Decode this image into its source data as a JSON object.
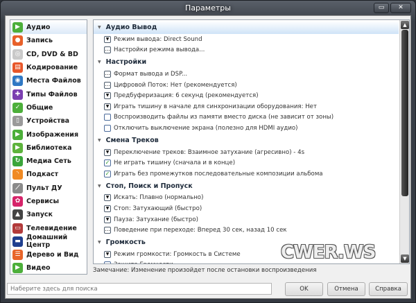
{
  "window": {
    "title": "Параметры",
    "maximize_icon": "maximize-icon",
    "close_icon": "close-icon"
  },
  "sidebar": {
    "items": [
      {
        "label": "Аудио",
        "icon": "audio-icon",
        "color": "#4caf3a",
        "glyph": "▶"
      },
      {
        "label": "Запись",
        "icon": "record-icon",
        "color": "#e8612a",
        "glyph": "●"
      },
      {
        "label": "CD, DVD & BD",
        "icon": "disc-icon",
        "color": "#c9c9c9",
        "glyph": "◎"
      },
      {
        "label": "Кодирование",
        "icon": "encode-icon",
        "color": "#e8572a",
        "glyph": "▤"
      },
      {
        "label": "Места Файлов",
        "icon": "globe-icon",
        "color": "#2f78c4",
        "glyph": "◉"
      },
      {
        "label": "Типы Файлов",
        "icon": "puzzle-icon",
        "color": "#7b3fb0",
        "glyph": "✚"
      },
      {
        "label": "Общие",
        "icon": "check-icon",
        "color": "#4caf3a",
        "glyph": "✓"
      },
      {
        "label": "Устройства",
        "icon": "device-icon",
        "color": "#9a9a9a",
        "glyph": "▯"
      },
      {
        "label": "Изображения",
        "icon": "images-icon",
        "color": "#4caf3a",
        "glyph": "▶"
      },
      {
        "label": "Библиотека",
        "icon": "library-icon",
        "color": "#5db33c",
        "glyph": "▶"
      },
      {
        "label": "Медиа Сеть",
        "icon": "network-icon",
        "color": "#3ba53b",
        "glyph": "↻"
      },
      {
        "label": "Подкаст",
        "icon": "rss-icon",
        "color": "#f08a24",
        "glyph": "◝"
      },
      {
        "label": "Пульт ДУ",
        "icon": "remote-icon",
        "color": "#8a8a8a",
        "glyph": "⟋"
      },
      {
        "label": "Сервисы",
        "icon": "services-icon",
        "color": "#d6246a",
        "glyph": "✿"
      },
      {
        "label": "Запуск",
        "icon": "launch-icon",
        "color": "#444444",
        "glyph": "▲"
      },
      {
        "label": "Телевидение",
        "icon": "tv-icon",
        "color": "#b23a3a",
        "glyph": "▭"
      },
      {
        "label": "Домашний Центр",
        "icon": "theater-icon",
        "color": "#1f3f8f",
        "glyph": "▬"
      },
      {
        "label": "Дерево и Вид",
        "icon": "tree-icon",
        "color": "#e8652a",
        "glyph": "☰"
      },
      {
        "label": "Видео",
        "icon": "video-icon",
        "color": "#4caf3a",
        "glyph": "▶"
      }
    ]
  },
  "sections": [
    {
      "title": "Аудио Вывод",
      "items": [
        {
          "type": "dropdown",
          "label": "Режим вывода: Direct Sound"
        },
        {
          "type": "ellipsis",
          "label": "Настройки режима вывода..."
        }
      ]
    },
    {
      "title": "Настройки",
      "items": [
        {
          "type": "ellipsis",
          "label": "Формат вывода и DSP..."
        },
        {
          "type": "ellipsis",
          "label": "Цифровой Поток: Нет (рекомендуется)"
        },
        {
          "type": "dropdown",
          "label": "Предбуферизация: 6 секунд (рекомендуется)"
        },
        {
          "type": "dropdown",
          "label": "Играть тишину в начале для синхронизации оборудования: Нет"
        },
        {
          "type": "checkbox",
          "checked": false,
          "label": "Воспроизводить файлы из памяти вместо диска (не зависит от зоны)"
        },
        {
          "type": "checkbox",
          "checked": false,
          "label": "Отключить выключение экрана (полезно для HDMI аудио)"
        }
      ]
    },
    {
      "title": "Смена Треков",
      "items": [
        {
          "type": "dropdown",
          "label": "Переключение треков: Взаимное затухание (агресивно) - 4s"
        },
        {
          "type": "checkbox",
          "checked": true,
          "label": "Не играть тишину (сначала и в конце)"
        },
        {
          "type": "checkbox",
          "checked": true,
          "label": "Играть без промежутков последовательные композиции альбома"
        }
      ]
    },
    {
      "title": "Стоп, Поиск и Пропуск",
      "items": [
        {
          "type": "dropdown",
          "label": "Искать: Плавно (нормально)"
        },
        {
          "type": "dropdown",
          "label": "Стоп: Затухающий (быстро)"
        },
        {
          "type": "dropdown",
          "label": "Пауза: Затухание (быстро)"
        },
        {
          "type": "ellipsis",
          "label": "Поведение при переходе: Вперед 30 сек, назад 10 сек"
        }
      ]
    },
    {
      "title": "Громкость",
      "items": [
        {
          "type": "dropdown",
          "label": "Режим громкости: Громкость в Системе"
        },
        {
          "type": "checkbox",
          "checked": false,
          "label": "Защита Громкости"
        }
      ]
    }
  ],
  "watermark": "CWER.WS",
  "note": "Замечание: Изменение произойдет после остановки воспроизведения",
  "search": {
    "placeholder": "Наберите здесь для поиска",
    "value": ""
  },
  "buttons": {
    "ok": "OK",
    "cancel": "Отмена",
    "help": "Справка"
  }
}
